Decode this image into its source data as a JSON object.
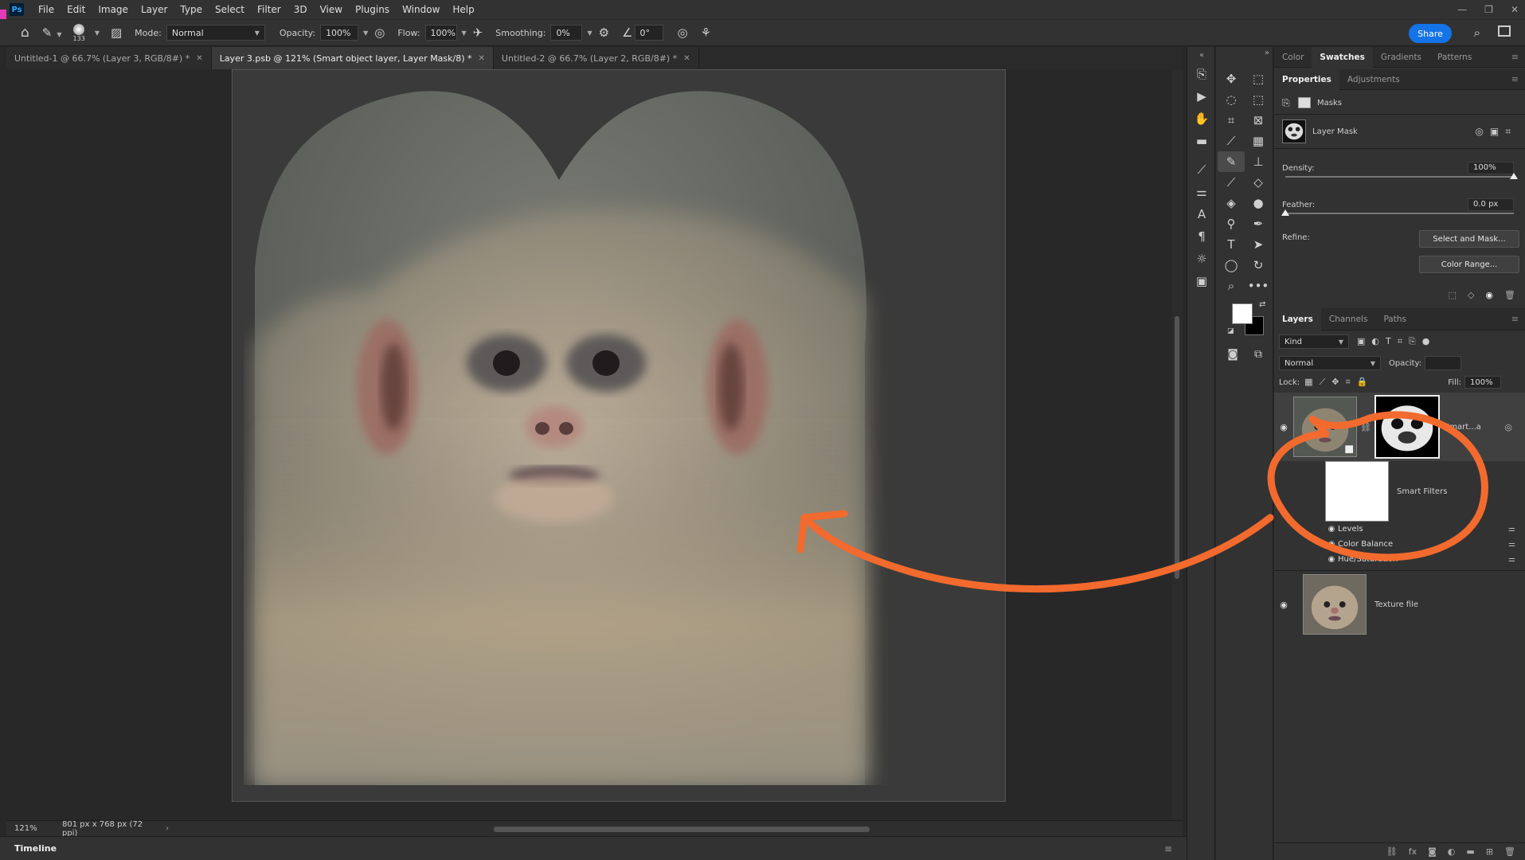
{
  "menu": [
    "File",
    "Edit",
    "Image",
    "Layer",
    "Type",
    "Select",
    "Filter",
    "3D",
    "View",
    "Plugins",
    "Window",
    "Help"
  ],
  "app_logo": "Ps",
  "window_controls": [
    "—",
    "❐",
    "✕"
  ],
  "options": {
    "brush_size": "133",
    "mode_label": "Mode:",
    "mode_value": "Normal",
    "opacity_label": "Opacity:",
    "opacity_value": "100%",
    "flow_label": "Flow:",
    "flow_value": "100%",
    "smoothing_label": "Smoothing:",
    "smoothing_value": "0%",
    "angle_value": "0°",
    "share_label": "Share"
  },
  "tabs": [
    {
      "label": "Untitled-1 @ 66.7% (Layer 3, RGB/8#) *",
      "active": false
    },
    {
      "label": "Layer 3.psb @ 121% (Smart object layer, Layer Mask/8) *",
      "active": true
    },
    {
      "label": "Untitled-2 @ 66.7% (Layer 2, RGB/8#) *",
      "active": false
    }
  ],
  "status": {
    "zoom": "121%",
    "doc_info": "801 px x 768 px (72 ppi)"
  },
  "timeline_label": "Timeline",
  "panels": {
    "top_tabs": [
      "Color",
      "Swatches",
      "Gradients",
      "Patterns"
    ],
    "top_active": "Swatches",
    "prop_tabs": [
      "Properties",
      "Adjustments"
    ],
    "prop_active": "Properties",
    "masks_label": "Masks",
    "layer_mask_label": "Layer Mask",
    "density_label": "Density:",
    "density_value": "100%",
    "density_level": 1.0,
    "feather_label": "Feather:",
    "feather_value": "0.0 px",
    "feather_level": 0.0,
    "refine_label": "Refine:",
    "select_mask_btn": "Select and Mask...",
    "color_range_btn": "Color Range...",
    "layer_tabs": [
      "Layers",
      "Channels",
      "Paths"
    ],
    "layer_active": "Layers",
    "kind_label": "Kind",
    "blend_mode": "Normal",
    "layer_opacity_label": "Opacity:",
    "lock_label": "Lock:",
    "fill_label": "Fill:",
    "fill_value": "100%",
    "layers": {
      "smart": "Smart...a",
      "smart_filters": "Smart Filters",
      "filters": [
        "Levels",
        "Color Balance",
        "Hue/Saturation"
      ],
      "texture": "Texture file"
    }
  },
  "colors": {
    "accent": "#1473e6",
    "annotation": "#f26a2e",
    "panel_bg": "#323232"
  }
}
